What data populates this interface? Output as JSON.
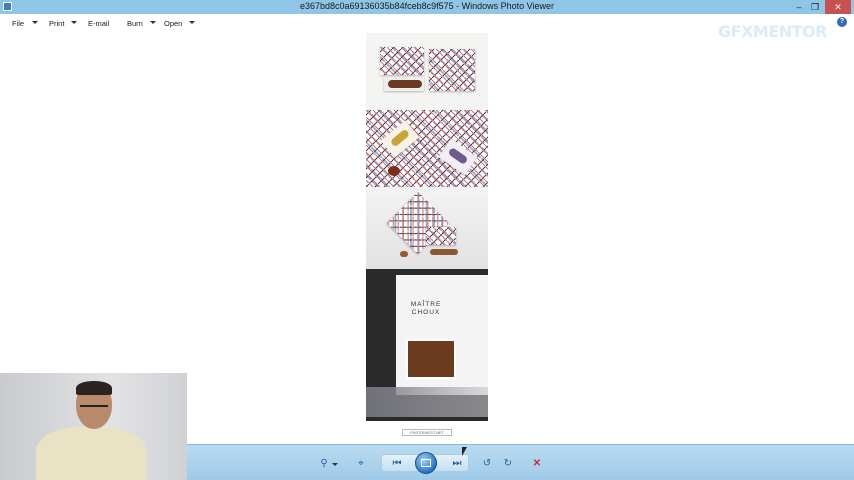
{
  "window": {
    "title": "e367bd8c0a69136035b84fceb8c9f575 - Windows Photo Viewer",
    "controls": {
      "minimize": "–",
      "maximize": "❐",
      "close": "✕"
    }
  },
  "menu": {
    "items": [
      {
        "label": "File",
        "has_dropdown": true
      },
      {
        "label": "Print",
        "has_dropdown": true
      },
      {
        "label": "E-mail",
        "has_dropdown": false
      },
      {
        "label": "Burn",
        "has_dropdown": true
      },
      {
        "label": "Open",
        "has_dropdown": true
      }
    ],
    "help_icon": "?"
  },
  "watermark": {
    "brand": "GFXMENTOR"
  },
  "image": {
    "shop_sign_line1": "MAÎTRE",
    "shop_sign_line2": "CHOUX",
    "caption": "PINTERNEST.NET"
  },
  "toolbar": {
    "zoom_icon": "⚲",
    "fit_icon": "⌖",
    "previous_icon": "⏮",
    "next_icon": "⏭",
    "rotate_left_icon": "↺",
    "rotate_right_icon": "↻",
    "delete_icon": "✕"
  },
  "colors": {
    "titlebar": "#8fc6e8",
    "toolbar": "#9fcbe8",
    "accent": "#2a74c2",
    "delete": "#d12b2b"
  }
}
